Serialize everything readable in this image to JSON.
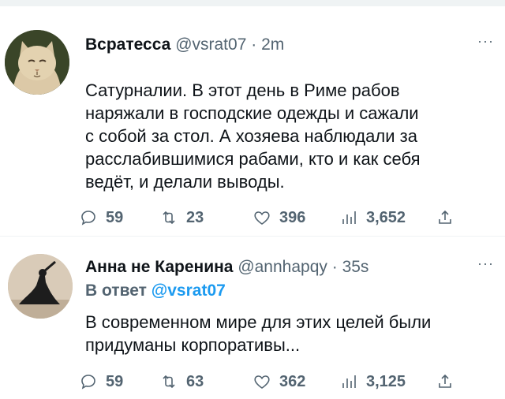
{
  "tweets": [
    {
      "author_name": "Всратесса",
      "handle": "@vsrat07",
      "separator": "·",
      "time": "2m",
      "text": "Сатурналии. В этот день в Риме рабов\nнаряжали в господские одежды и сажали\nс собой за стол. А хозяева наблюдали за\nрасслабившимися рабами, кто и как себя\nведёт, и делали выводы.",
      "more_label": "···",
      "replies": "59",
      "retweets": "23",
      "likes": "396",
      "views": "3,652",
      "avatar_icon": "cat-avatar-icon"
    },
    {
      "author_name": "Анна не Каренина",
      "handle": "@annhapqy",
      "separator": "·",
      "time": "35s",
      "reply_prefix": "В ответ",
      "reply_to": "@vsrat07",
      "text": "В современном мире для этих целей были\nпридуманы корпоративы...",
      "more_label": "···",
      "replies": "59",
      "retweets": "63",
      "likes": "362",
      "views": "3,125",
      "avatar_icon": "person-silhouette-avatar-icon"
    }
  ],
  "colors": {
    "text": "#0f1419",
    "secondary": "#536471",
    "link": "#1d9bf0",
    "divider": "#eff3f4"
  }
}
